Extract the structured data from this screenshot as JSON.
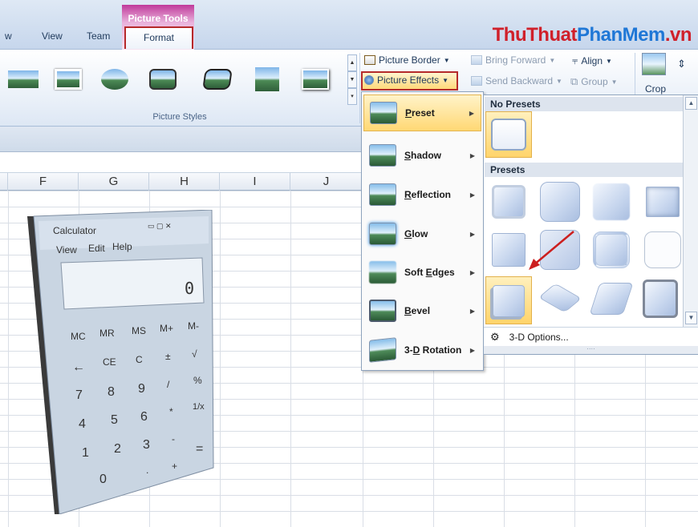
{
  "tabs": {
    "view": "View",
    "team": "Team",
    "format": "Format",
    "cutoff": "w"
  },
  "contextual_tab": "Picture Tools",
  "brand": {
    "part1": "ThuThuat",
    "part2": "PhanMem",
    "part3": ".vn"
  },
  "ribbon": {
    "styles_group_label": "Picture Styles",
    "picture_border": "Picture Border",
    "picture_effects": "Picture Effects",
    "bring_forward": "Bring Forward",
    "send_backward": "Send Backward",
    "align": "Align",
    "group": "Group",
    "crop": "Crop"
  },
  "columns": [
    "F",
    "G",
    "H",
    "I",
    "J"
  ],
  "calculator": {
    "title": "Calculator",
    "menu": [
      "View",
      "Edit",
      "Help"
    ],
    "display": "0",
    "keys": [
      [
        "MC",
        "MR",
        "MS",
        "M+",
        "M-"
      ],
      [
        "←",
        "CE",
        "C",
        "±",
        "√"
      ],
      [
        "7",
        "8",
        "9",
        "/",
        "%"
      ],
      [
        "4",
        "5",
        "6",
        "*",
        "1/x"
      ],
      [
        "1",
        "2",
        "3",
        "-",
        "="
      ],
      [
        "0",
        ".",
        "+"
      ]
    ]
  },
  "effects_menu": {
    "items": [
      {
        "label": "Preset",
        "mnemonic": "P",
        "rest": "reset",
        "selected": true
      },
      {
        "label": "Shadow",
        "mnemonic": "S",
        "rest": "hadow",
        "selected": false
      },
      {
        "label": "Reflection",
        "mnemonic": "R",
        "rest": "eflection",
        "selected": false
      },
      {
        "label": "Glow",
        "mnemonic": "G",
        "rest": "low",
        "selected": false
      },
      {
        "label": "Soft Edges",
        "mnemonic": "E",
        "rest": "dges",
        "prefix": "Soft ",
        "selected": false
      },
      {
        "label": "Bevel",
        "mnemonic": "B",
        "rest": "evel",
        "selected": false
      },
      {
        "label": "3-D Rotation",
        "mnemonic": "D",
        "prefix": "3-",
        "rest": " Rotation",
        "selected": false
      }
    ]
  },
  "preset_panel": {
    "no_presets_header": "No Presets",
    "presets_header": "Presets",
    "options_label": "3-D Options...",
    "options_mnemonic": "O",
    "highlighted_preset": 9
  },
  "colors": {
    "accent_red": "#b52a2a",
    "brand_red": "#d0202a",
    "brand_blue": "#1f77d6",
    "highlight": "#ffd874"
  }
}
